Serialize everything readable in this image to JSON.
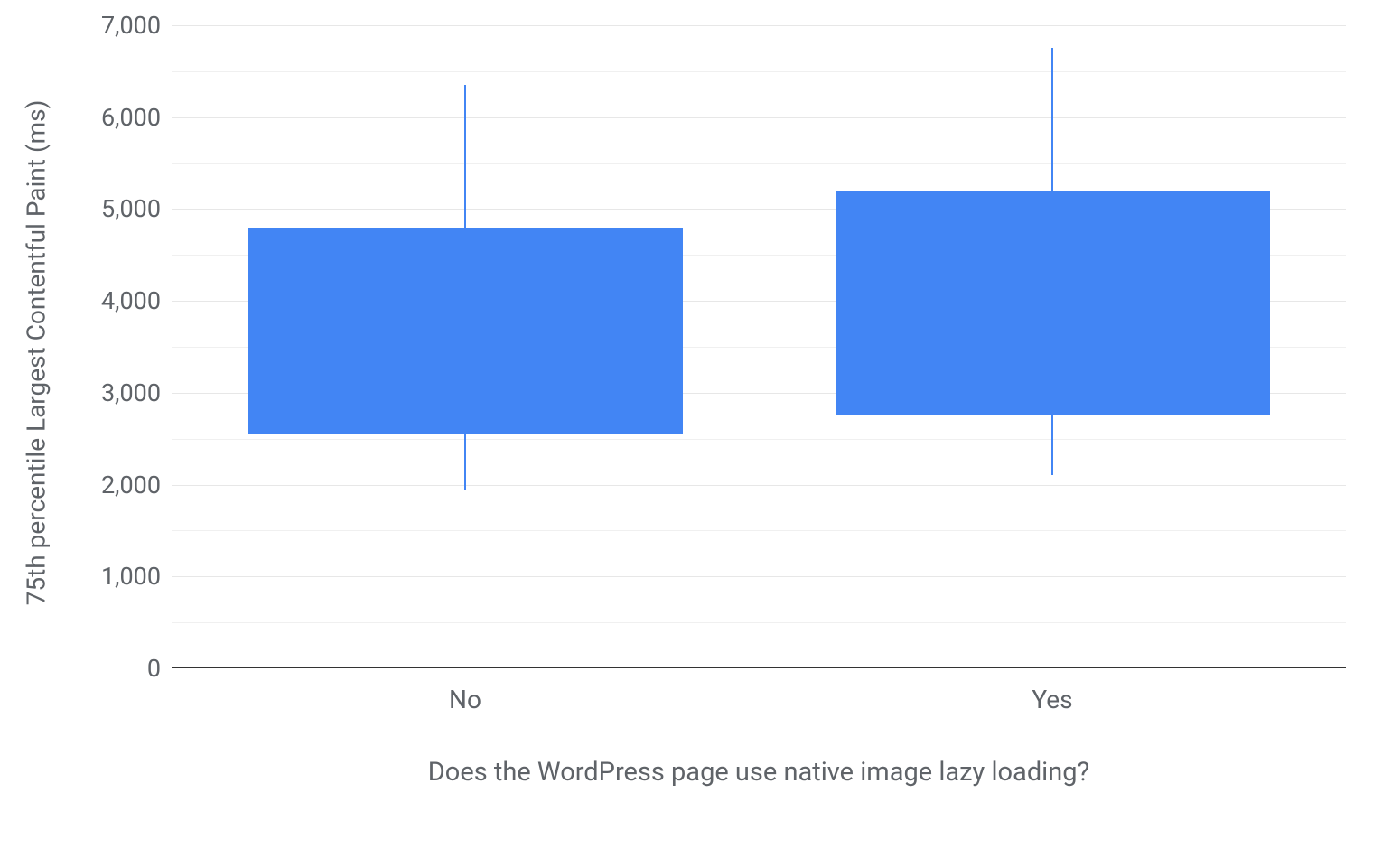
{
  "chart_data": {
    "type": "boxplot",
    "xlabel": "Does the WordPress page use native image lazy loading?",
    "ylabel": "75th percentile Largest Contentful Paint (ms)",
    "categories": [
      "No",
      "Yes"
    ],
    "series": [
      {
        "name": "No",
        "low": 1950,
        "q1": 2550,
        "q3": 4800,
        "high": 6350
      },
      {
        "name": "Yes",
        "low": 2100,
        "q1": 2750,
        "q3": 5200,
        "high": 6750
      }
    ],
    "ylim": [
      0,
      7000
    ],
    "y_ticks_major": [
      0,
      1000,
      2000,
      3000,
      4000,
      5000,
      6000,
      7000
    ],
    "y_ticks_minor": [
      500,
      1500,
      2500,
      3500,
      4500,
      5500,
      6500
    ],
    "y_tick_labels": [
      "0",
      "1,000",
      "2,000",
      "3,000",
      "4,000",
      "5,000",
      "6,000",
      "7,000"
    ],
    "bar_color": "#4285f4"
  }
}
